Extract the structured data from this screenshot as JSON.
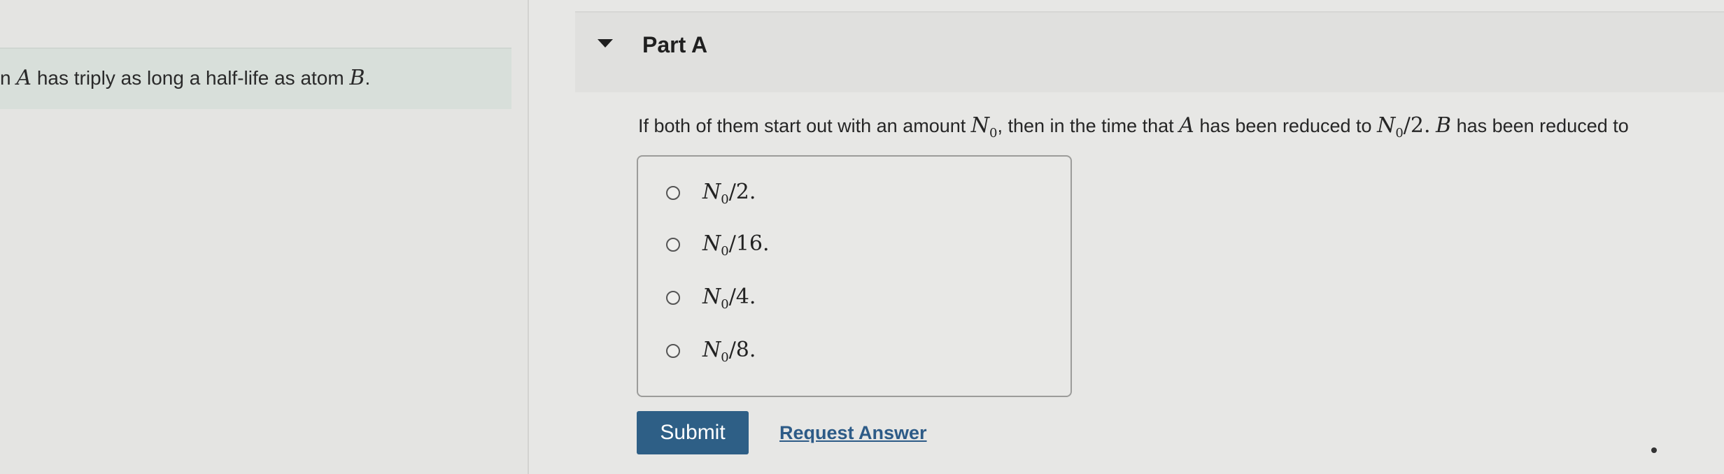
{
  "problem": {
    "prefix": "n",
    "atom_a": "A",
    "text_middle": "has triply as long a half-life as atom",
    "atom_b": "B",
    "suffix": "."
  },
  "part": {
    "title": "Part A"
  },
  "question": {
    "text1": "If both of them start out with an amount",
    "n0": "N",
    "n0_sub": "0",
    "text2": ", then in the time that",
    "atom_a": "A",
    "text3": "has been reduced to",
    "reduced_expr": "N",
    "reduced_sub": "0",
    "reduced_tail": "/2.",
    "atom_b": "B",
    "text4": "has been reduced to"
  },
  "options": [
    {
      "label": "N",
      "sub": "0",
      "tail": "/2."
    },
    {
      "label": "N",
      "sub": "0",
      "tail": "/16."
    },
    {
      "label": "N",
      "sub": "0",
      "tail": "/4."
    },
    {
      "label": "N",
      "sub": "0",
      "tail": "/8."
    }
  ],
  "actions": {
    "submit_label": "Submit",
    "request_answer_label": "Request Answer"
  }
}
